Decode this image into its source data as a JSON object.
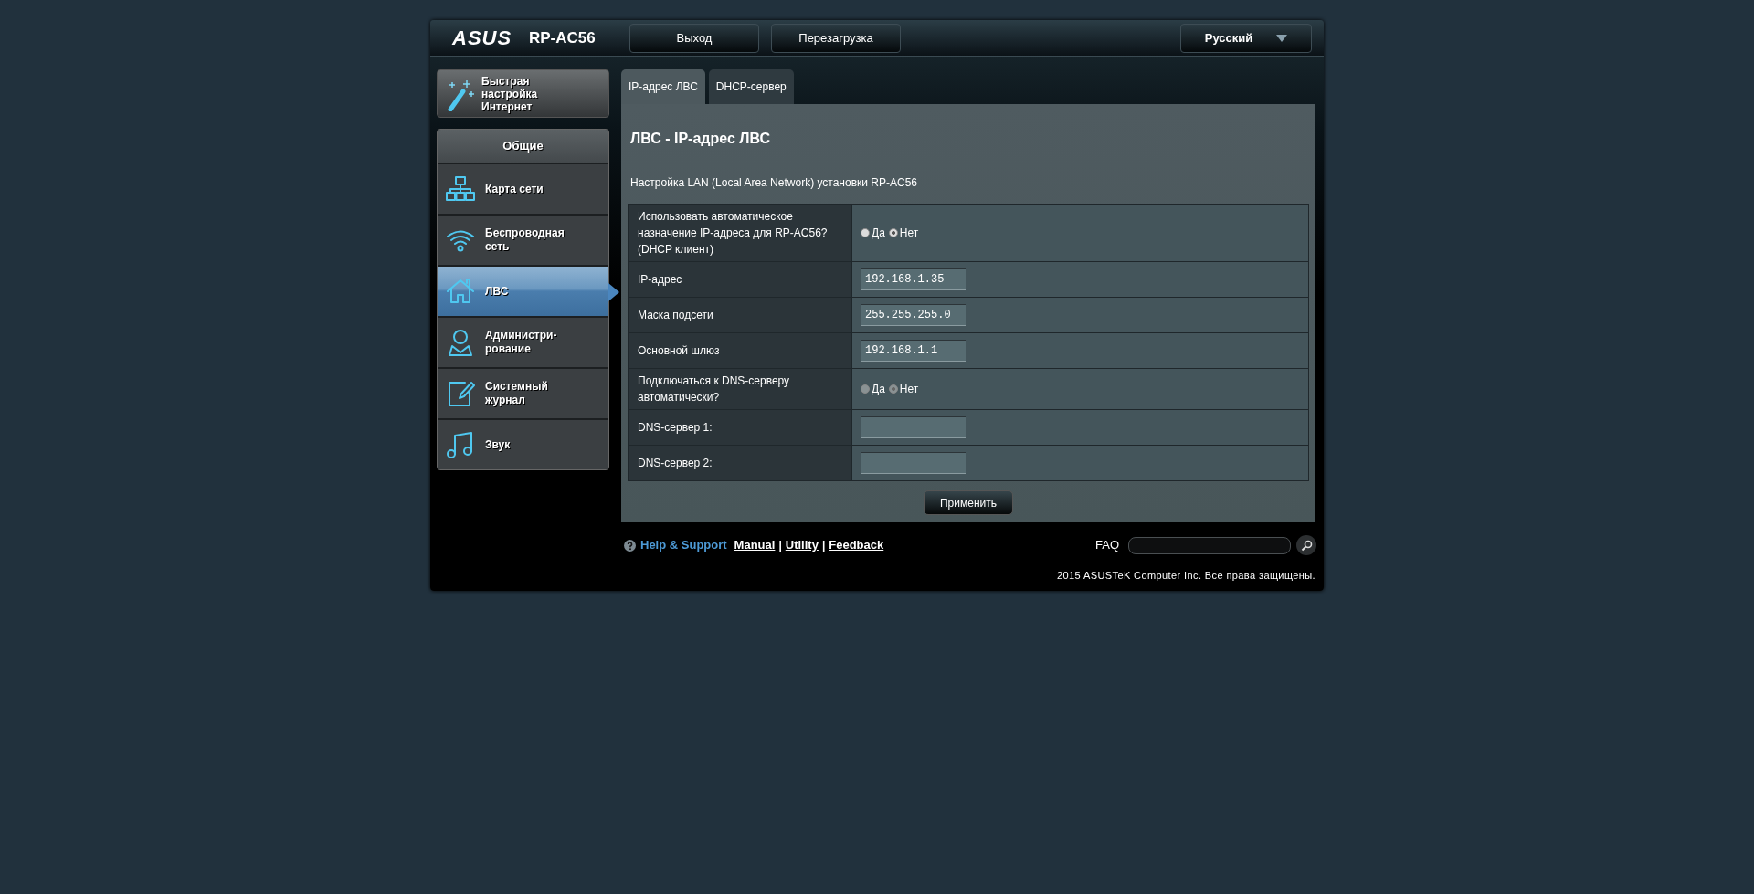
{
  "header": {
    "logo": "ASUS",
    "model": "RP-AC56",
    "buttons": [
      "Выход",
      "Перезагрузка"
    ],
    "language": "Русский"
  },
  "quick_setup": {
    "label": "Быстрая настройка Интернет"
  },
  "sidebar": {
    "title": "Общие",
    "items": [
      {
        "label": "Карта сети",
        "kind": "network",
        "selected": false
      },
      {
        "label": "Беспроводная сеть",
        "kind": "wifi",
        "selected": false
      },
      {
        "label": "ЛВС",
        "kind": "home",
        "selected": true
      },
      {
        "label": "Администри-рование",
        "kind": "user",
        "selected": false
      },
      {
        "label": "Системный журнал",
        "kind": "log",
        "selected": false
      },
      {
        "label": "Звук",
        "kind": "music",
        "selected": false
      }
    ]
  },
  "tabs": [
    {
      "label": "IP-адрес ЛВС",
      "selected": true
    },
    {
      "label": "DHCP-сервер",
      "selected": false
    }
  ],
  "page": {
    "title": "ЛВС - IP-адрес ЛВС",
    "description": "Настройка LAN (Local Area Network) установки RP-AC56"
  },
  "form": [
    {
      "kind": "radio",
      "label": "Использовать автоматическое назначение IP-адреса для RP-AC56? (DHCP клиент)",
      "disabled": false,
      "options": [
        {
          "label": "Да",
          "selected": false
        },
        {
          "label": "Нет",
          "selected": true
        }
      ]
    },
    {
      "kind": "text",
      "label": "IP-адрес",
      "value": "192.168.1.35"
    },
    {
      "kind": "text",
      "label": "Маска подсети",
      "value": "255.255.255.0"
    },
    {
      "kind": "text",
      "label": "Основной шлюз",
      "value": "192.168.1.1"
    },
    {
      "kind": "radio",
      "label": "Подключаться к DNS-серверу автоматически?",
      "disabled": true,
      "options": [
        {
          "label": "Да",
          "selected": false
        },
        {
          "label": "Нет",
          "selected": true
        }
      ]
    },
    {
      "kind": "text",
      "label": "DNS-сервер 1:"
    },
    {
      "kind": "text",
      "label": "DNS-сервер 2:"
    }
  ],
  "apply_button": "Применить",
  "footer": {
    "help": "Help & Support",
    "links": [
      "Manual",
      "Utility",
      "Feedback"
    ],
    "separators": [
      "|",
      "|"
    ],
    "faq": "FAQ",
    "copyright": "2015 ASUSTeK Computer Inc. Все права защищены."
  }
}
